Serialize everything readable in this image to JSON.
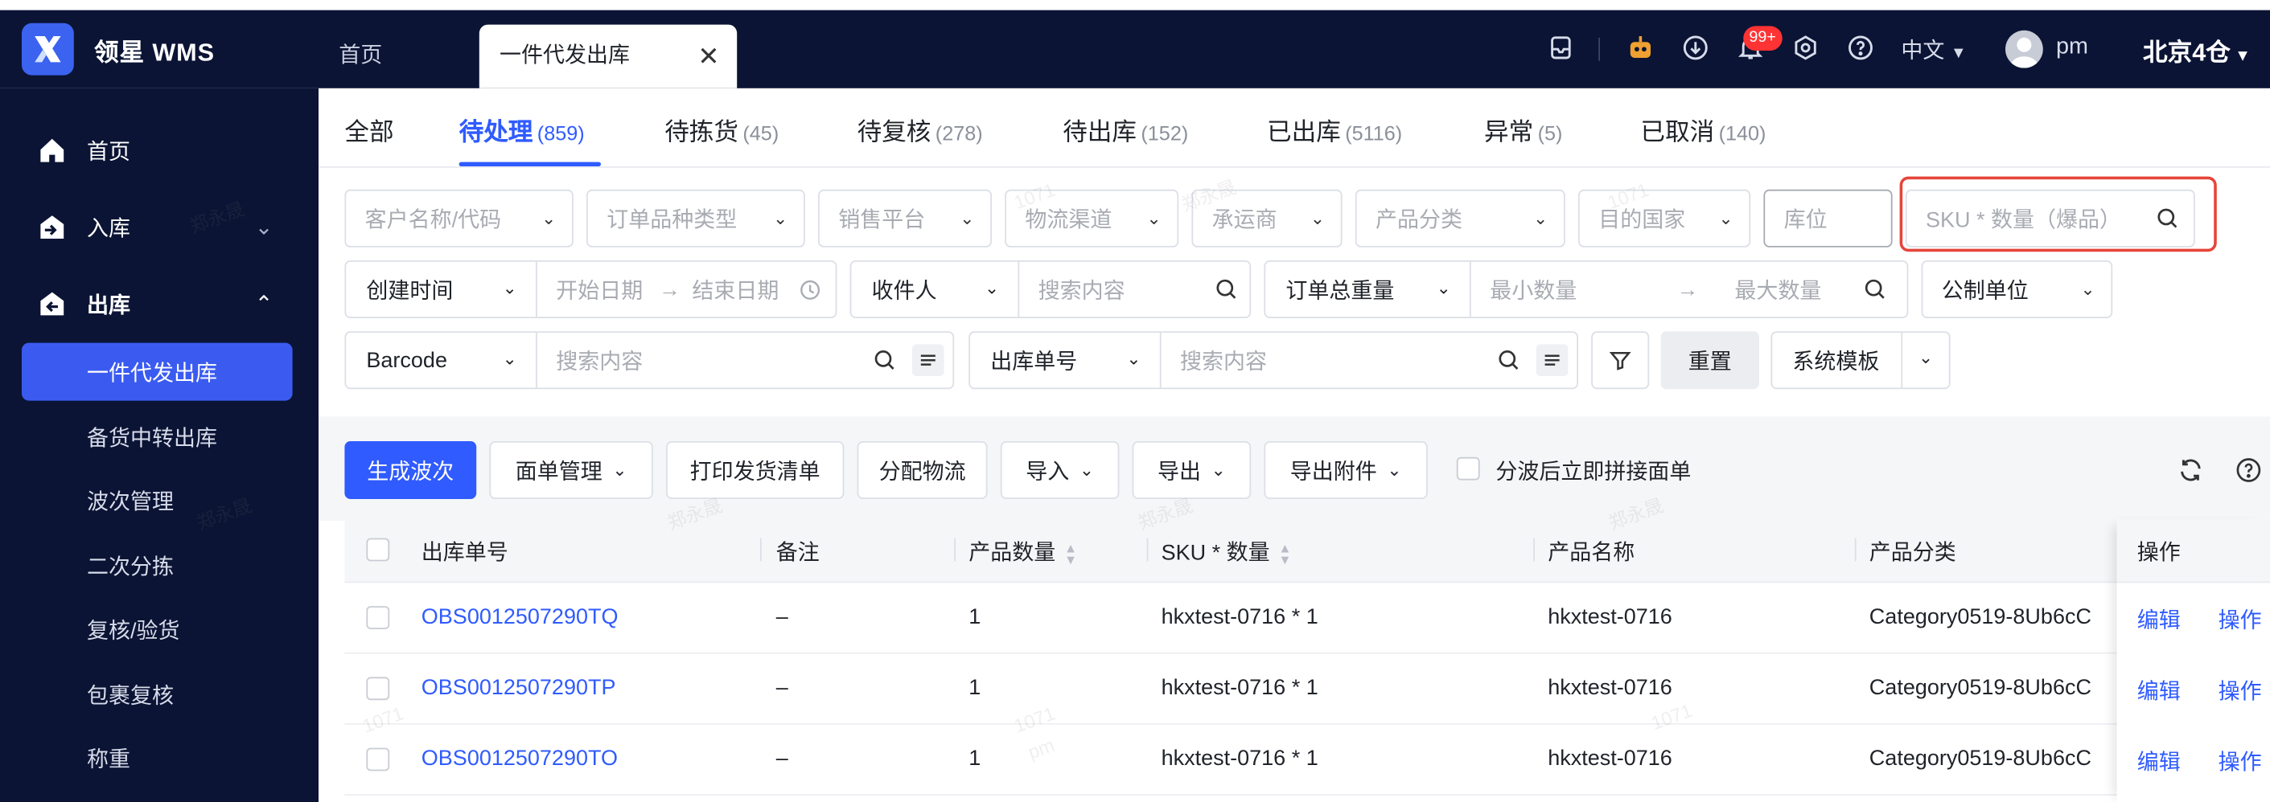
{
  "app": {
    "brand": "领星 WMS",
    "warehouse": "北京4仓"
  },
  "top_tabs": [
    {
      "label": "首页"
    },
    {
      "label": "一件代发出库"
    }
  ],
  "header": {
    "notification_badge": "99+",
    "language": "中文",
    "username": "pm"
  },
  "sidebar": {
    "items": [
      {
        "label": "首页"
      },
      {
        "label": "入库"
      },
      {
        "label": "出库"
      }
    ],
    "sub_items": [
      {
        "label": "一件代发出库"
      },
      {
        "label": "备货中转出库"
      },
      {
        "label": "波次管理"
      },
      {
        "label": "二次分拣"
      },
      {
        "label": "复核/验货"
      },
      {
        "label": "包裹复核"
      },
      {
        "label": "称重"
      }
    ]
  },
  "status_tabs": [
    {
      "label": "全部",
      "count": ""
    },
    {
      "label": "待处理",
      "count": "(859)"
    },
    {
      "label": "待拣货",
      "count": "(45)"
    },
    {
      "label": "待复核",
      "count": "(278)"
    },
    {
      "label": "待出库",
      "count": "(152)"
    },
    {
      "label": "已出库",
      "count": "(5116)"
    },
    {
      "label": "异常",
      "count": "(5)"
    },
    {
      "label": "已取消",
      "count": "(140)"
    }
  ],
  "filters": {
    "row1": [
      "客户名称/代码",
      "订单品种类型",
      "销售平台",
      "物流渠道",
      "承运商",
      "产品分类",
      "目的国家"
    ],
    "location_placeholder": "库位",
    "sku_placeholder": "SKU * 数量（爆品）",
    "created_time": "创建时间",
    "start_date": "开始日期",
    "end_date": "结束日期",
    "arrow": "→",
    "receiver": "收件人",
    "search_placeholder": "搜索内容",
    "total_weight": "订单总重量",
    "min_qty": "最小数量",
    "max_qty": "最大数量",
    "unit": "公制单位",
    "barcode": "Barcode",
    "outbound_no": "出库单号",
    "reset": "重置",
    "template": "系统模板"
  },
  "actions": {
    "create_wave": "生成波次",
    "waybill_mgmt": "面单管理",
    "print_list": "打印发货清单",
    "assign_logistics": "分配物流",
    "import": "导入",
    "export": "导出",
    "export_attachment": "导出附件",
    "merge_label": "分波后立即拼接面单"
  },
  "table": {
    "columns": [
      "出库单号",
      "备注",
      "产品数量",
      "SKU * 数量",
      "产品名称",
      "产品分类",
      "操作"
    ],
    "rows": [
      {
        "order_no": "OBS0012507290TQ",
        "note": "–",
        "qty": "1",
        "sku": "hkxtest-0716 * 1",
        "name": "hkxtest-0716",
        "category": "Category0519-8Ub6cC",
        "edit": "编辑",
        "op": "操作"
      },
      {
        "order_no": "OBS0012507290TP",
        "note": "–",
        "qty": "1",
        "sku": "hkxtest-0716 * 1",
        "name": "hkxtest-0716",
        "category": "Category0519-8Ub6cC",
        "edit": "编辑",
        "op": "操作"
      },
      {
        "order_no": "OBS0012507290TO",
        "note": "–",
        "qty": "1",
        "sku": "hkxtest-0716 * 1",
        "name": "hkxtest-0716",
        "category": "Category0519-8Ub6cC",
        "edit": "编辑",
        "op": "操作"
      }
    ]
  },
  "watermark": {
    "name": "郑永晟",
    "id": "1071",
    "user": "pm"
  },
  "colors": {
    "primary": "#2f5bff",
    "sidebar_bg": "#0b1434",
    "highlight_border": "#e6453a"
  }
}
